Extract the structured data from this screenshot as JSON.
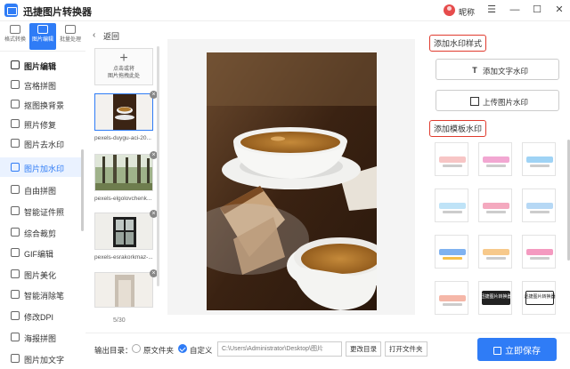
{
  "window": {
    "title": "迅捷图片转换器",
    "nickname": "昵称",
    "controls": {
      "minimize": "—",
      "maximize": "☐",
      "close": "✕",
      "menu": "☰"
    }
  },
  "rail": [
    {
      "label": "格式转换"
    },
    {
      "label": "图片编辑"
    },
    {
      "label": "批量处理"
    }
  ],
  "sidebar": {
    "header": "图片编辑",
    "items": [
      {
        "label": "宫格拼图"
      },
      {
        "label": "抠图换背景"
      },
      {
        "label": "照片修复"
      },
      {
        "label": "图片去水印"
      },
      {
        "label": "图片加水印"
      },
      {
        "label": "自由拼图"
      },
      {
        "label": "智能证件照"
      },
      {
        "label": "综合裁剪"
      },
      {
        "label": "GIF编辑"
      },
      {
        "label": "图片美化"
      },
      {
        "label": "智能消除笔"
      },
      {
        "label": "修改DPI"
      },
      {
        "label": "海报拼图"
      },
      {
        "label": "图片加文字"
      }
    ]
  },
  "thumbs": {
    "back": "返回",
    "upload_line1": "点击或将",
    "upload_line2": "图片拖拽此处",
    "items": [
      {
        "name": "pexels-duygu-aci-20..."
      },
      {
        "name": "pexels-elgolovchenk..."
      },
      {
        "name": "pexels-esrakorkmaz-..."
      },
      {
        "name": ""
      }
    ],
    "page_count": "5/30"
  },
  "right": {
    "style_title": "添加水印样式",
    "text_wm": "添加文字水印",
    "image_wm": "上传图片水印",
    "template_title": "添加模板水印",
    "templates": [
      {
        "text": ""
      },
      {
        "text": ""
      },
      {
        "text": ""
      },
      {
        "text": ""
      },
      {
        "text": ""
      },
      {
        "text": ""
      },
      {
        "text": ""
      },
      {
        "text": ""
      },
      {
        "text": ""
      },
      {
        "text": ""
      },
      {
        "text": "迅捷图片转换器"
      },
      {
        "text": "迅捷图片转换器"
      }
    ]
  },
  "bottom": {
    "output_label": "输出目录：",
    "option_original": "原文件夹",
    "option_custom": "自定义",
    "path_placeholder": "C:\\Users\\Administrator\\Desktop\\图片",
    "change_dir": "更改目录",
    "open_folder": "打开文件夹",
    "save": "立即保存"
  },
  "colors": {
    "accent": "#2f7cf6",
    "highlight_box": "#e03b2e"
  }
}
